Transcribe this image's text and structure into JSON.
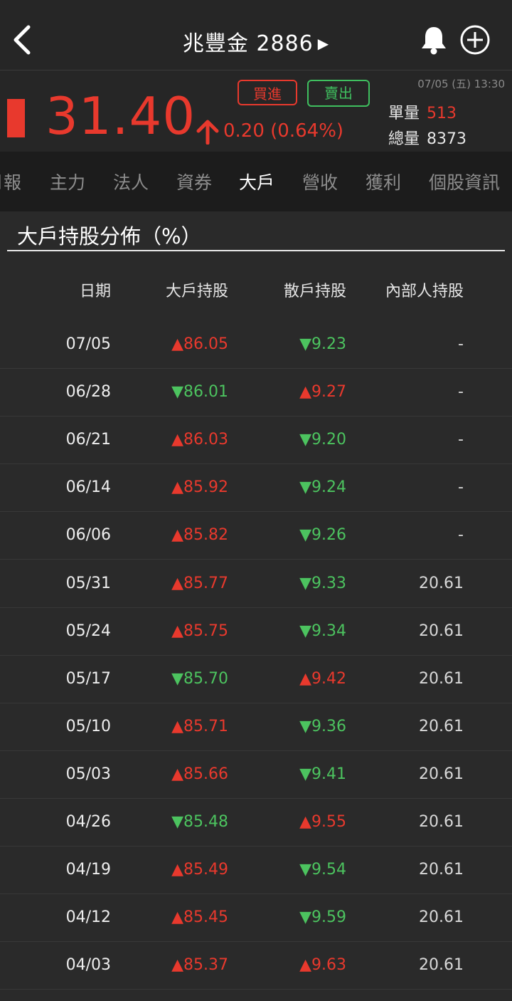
{
  "header": {
    "title": "兆豐金 2886",
    "title_arrow": "▶"
  },
  "quote": {
    "price": "31.40",
    "change": "0.20 (0.64%)",
    "datetime": "07/05 (五) 13:30",
    "buy_label": "買進",
    "sell_label": "賣出",
    "single_volume_label": "單量",
    "single_volume": "513",
    "total_volume_label": "總量",
    "total_volume": "8373",
    "up_color": "#e8392d",
    "down_color": "#4cc35f"
  },
  "tabs": [
    {
      "label": "月報"
    },
    {
      "label": "主力"
    },
    {
      "label": "法人"
    },
    {
      "label": "資券"
    },
    {
      "label": "大戶"
    },
    {
      "label": "營收"
    },
    {
      "label": "獲利"
    },
    {
      "label": "個股資訊"
    }
  ],
  "active_tab": "大戶",
  "section": {
    "title": "大戶持股分佈（%）"
  },
  "table": {
    "headers": {
      "date": "日期",
      "big": "大戶持股",
      "retail": "散戶持股",
      "insider": "內部人持股"
    },
    "rows": [
      {
        "date": "07/05",
        "big": "▲86.05",
        "big_dir": "up",
        "retail": "▼9.23",
        "retail_dir": "down",
        "insider": "-"
      },
      {
        "date": "06/28",
        "big": "▼86.01",
        "big_dir": "down",
        "retail": "▲9.27",
        "retail_dir": "up",
        "insider": "-"
      },
      {
        "date": "06/21",
        "big": "▲86.03",
        "big_dir": "up",
        "retail": "▼9.20",
        "retail_dir": "down",
        "insider": "-"
      },
      {
        "date": "06/14",
        "big": "▲85.92",
        "big_dir": "up",
        "retail": "▼9.24",
        "retail_dir": "down",
        "insider": "-"
      },
      {
        "date": "06/06",
        "big": "▲85.82",
        "big_dir": "up",
        "retail": "▼9.26",
        "retail_dir": "down",
        "insider": "-"
      },
      {
        "date": "05/31",
        "big": "▲85.77",
        "big_dir": "up",
        "retail": "▼9.33",
        "retail_dir": "down",
        "insider": "20.61"
      },
      {
        "date": "05/24",
        "big": "▲85.75",
        "big_dir": "up",
        "retail": "▼9.34",
        "retail_dir": "down",
        "insider": "20.61"
      },
      {
        "date": "05/17",
        "big": "▼85.70",
        "big_dir": "down",
        "retail": "▲9.42",
        "retail_dir": "up",
        "insider": "20.61"
      },
      {
        "date": "05/10",
        "big": "▲85.71",
        "big_dir": "up",
        "retail": "▼9.36",
        "retail_dir": "down",
        "insider": "20.61"
      },
      {
        "date": "05/03",
        "big": "▲85.66",
        "big_dir": "up",
        "retail": "▼9.41",
        "retail_dir": "down",
        "insider": "20.61"
      },
      {
        "date": "04/26",
        "big": "▼85.48",
        "big_dir": "down",
        "retail": "▲9.55",
        "retail_dir": "up",
        "insider": "20.61"
      },
      {
        "date": "04/19",
        "big": "▲85.49",
        "big_dir": "up",
        "retail": "▼9.54",
        "retail_dir": "down",
        "insider": "20.61"
      },
      {
        "date": "04/12",
        "big": "▲85.45",
        "big_dir": "up",
        "retail": "▼9.59",
        "retail_dir": "down",
        "insider": "20.61"
      },
      {
        "date": "04/03",
        "big": "▲85.37",
        "big_dir": "up",
        "retail": "▲9.63",
        "retail_dir": "up",
        "insider": "20.61"
      }
    ]
  }
}
